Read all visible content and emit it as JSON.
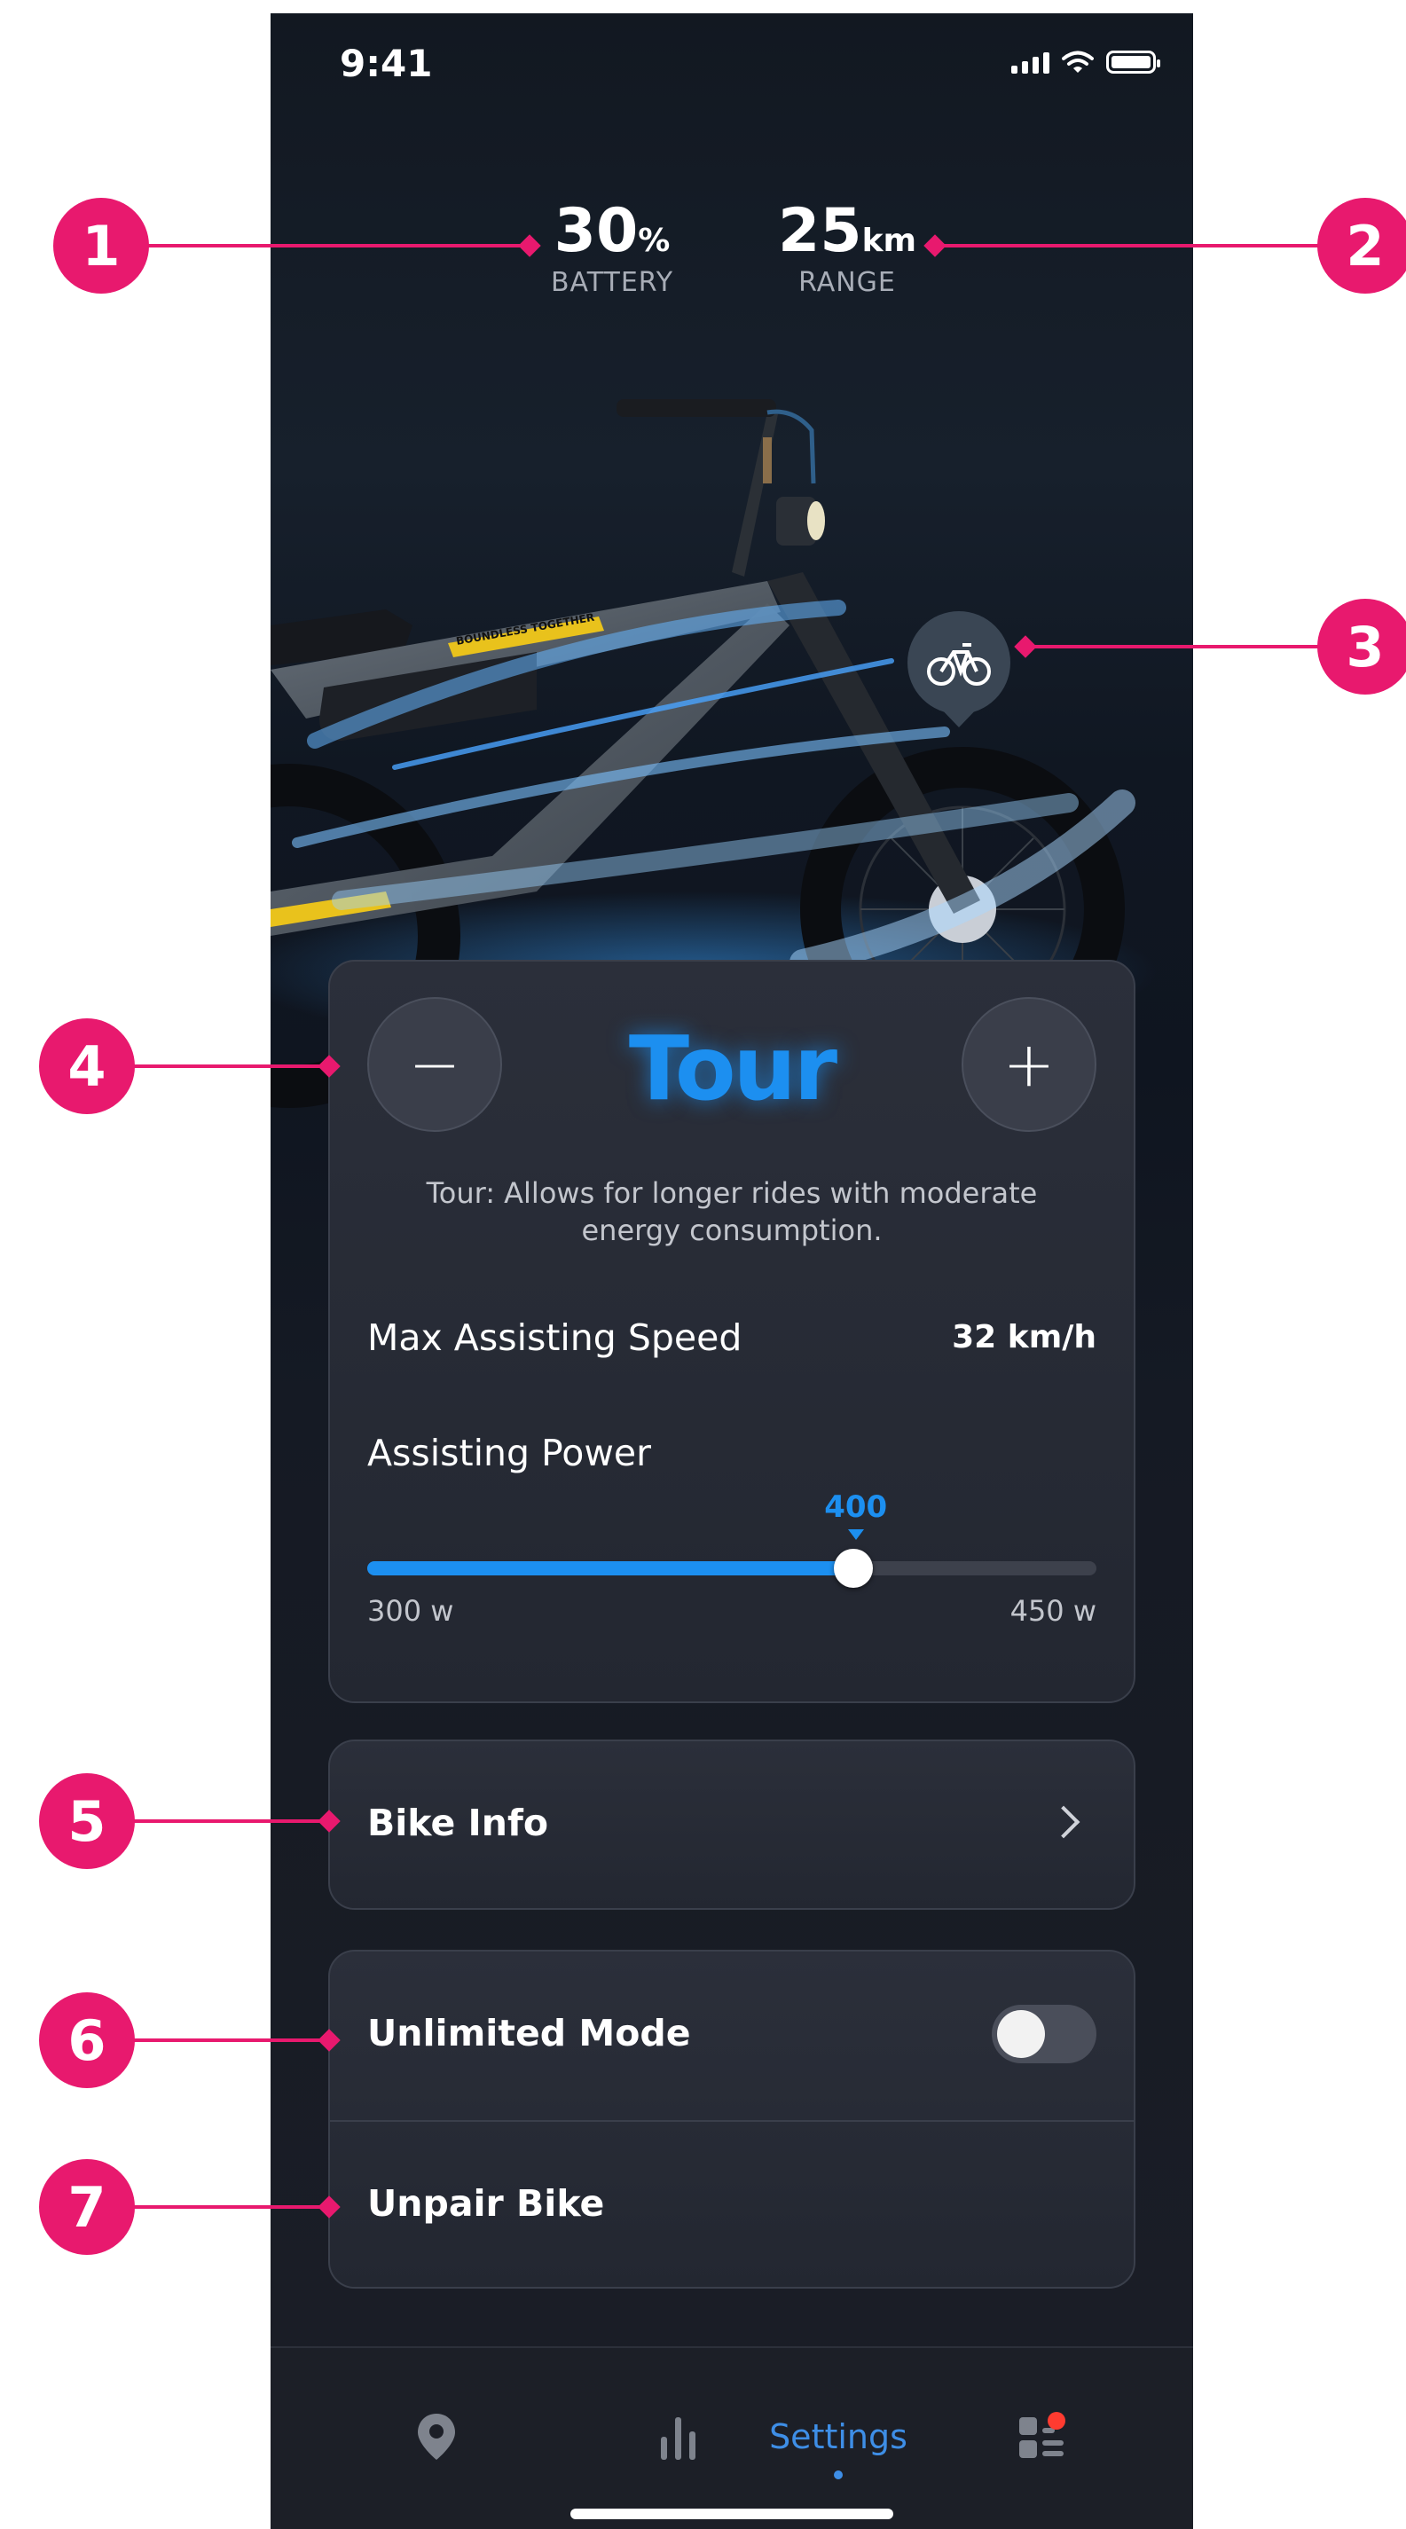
{
  "status_bar": {
    "time": "9:41"
  },
  "stats": {
    "battery": {
      "value": "30",
      "unit": "%",
      "label": "BATTERY"
    },
    "range": {
      "value": "25",
      "unit": "km",
      "label": "RANGE"
    }
  },
  "bike_decal": "BOUNDLESS TOGETHER",
  "mode_card": {
    "minus": "−",
    "plus": "+",
    "mode": "Tour",
    "description": "Tour: Allows for longer rides with moderate energy consumption.",
    "max_speed_label": "Max Assisting Speed",
    "max_speed_value": "32 km/h",
    "power_label": "Assisting Power",
    "power_value": "400",
    "power_min": "300 w",
    "power_max": "450 w",
    "power_fraction": 0.6667
  },
  "bike_info": {
    "label": "Bike Info"
  },
  "options": {
    "unlimited_mode": "Unlimited Mode",
    "unlimited_mode_on": false,
    "unpair": "Unpair Bike"
  },
  "tabbar": {
    "settings": "Settings"
  },
  "callouts": [
    "1",
    "2",
    "3",
    "4",
    "5",
    "6",
    "7"
  ],
  "colors": {
    "accent": "#1c8ff0",
    "callout": "#e8196e",
    "notification": "#ff3b30"
  },
  "icons": [
    "bike-icon",
    "map-pin-icon",
    "stats-icon",
    "dashboard-icon",
    "chevron-right-icon"
  ]
}
